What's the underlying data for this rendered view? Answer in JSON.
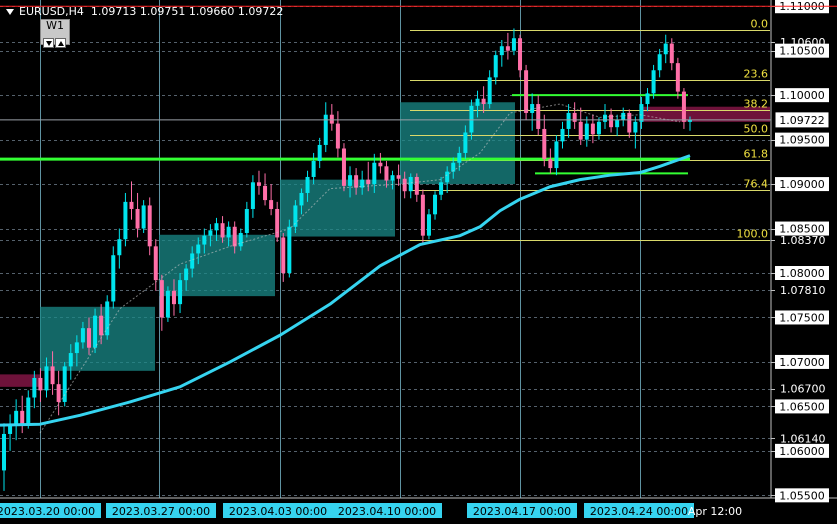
{
  "header": {
    "symbol": "EURUSD,H4",
    "ohlc": "1.09713 1.09751 1.09660 1.09722",
    "timeframe_button": "W1"
  },
  "colors": {
    "background": "#000000",
    "bull_candle": "#00e5ee",
    "bear_candle": "#ff6fa8",
    "ma_line": "#36d4f0",
    "fib_lines": "#d9d96a",
    "fib_labels": "#f0e040",
    "green_line": "#33ff33",
    "zone_fill": "#1a8a88",
    "supply_zone": "#7a1440",
    "grid": "#7a8a9a",
    "axis_text": "#ffffff",
    "current_price_bg": "#ffffff"
  },
  "chart_data": {
    "type": "candlestick",
    "symbol": "EURUSD",
    "timeframe": "H4",
    "y_ticks": [
      "1.11000",
      "1.10600",
      "1.10500",
      "1.10000",
      "1.09500",
      "1.09000",
      "1.08500",
      "1.08370",
      "1.08000",
      "1.07810",
      "1.07500",
      "1.07000",
      "1.06700",
      "1.06500",
      "1.06140",
      "1.06000",
      "1.05500"
    ],
    "y_ticks_boxed": [
      "1.11000",
      "1.10500",
      "1.10000",
      "1.09500",
      "1.09000",
      "1.08500",
      "1.08000",
      "1.07500",
      "1.07000",
      "1.06500",
      "1.06000",
      "1.05500"
    ],
    "y_range": [
      1.0547,
      1.1107
    ],
    "current_price": "1.09722",
    "x_labels": [
      {
        "text": "2023.03.20 00:00",
        "boxed": true
      },
      {
        "text": "2023.03.27 00:00",
        "boxed": true
      },
      {
        "text": "2023.04.03 00:00",
        "boxed": true
      },
      {
        "text": "2023.04.10 00:00",
        "boxed": true
      },
      {
        "text": "2023.04.17 00:00",
        "boxed": true
      },
      {
        "text": "2023.04.24 00:00",
        "boxed": true
      },
      {
        "text": "Apr 12:00",
        "boxed": false
      }
    ],
    "candles": [
      [
        1.0578,
        1.0631,
        1.0555,
        1.0619
      ],
      [
        1.0619,
        1.0641,
        1.06,
        1.0628
      ],
      [
        1.0628,
        1.0658,
        1.0612,
        1.0645
      ],
      [
        1.0645,
        1.0662,
        1.062,
        1.063
      ],
      [
        1.063,
        1.0668,
        1.0625,
        1.066
      ],
      [
        1.066,
        1.069,
        1.0648,
        1.0682
      ],
      [
        1.0682,
        1.0693,
        1.0655,
        1.0668
      ],
      [
        1.0668,
        1.0705,
        1.066,
        1.0695
      ],
      [
        1.0695,
        1.0712,
        1.0663,
        1.0675
      ],
      [
        1.0675,
        1.069,
        1.064,
        1.0655
      ],
      [
        1.0655,
        1.07,
        1.065,
        1.0695
      ],
      [
        1.0695,
        1.072,
        1.068,
        1.071
      ],
      [
        1.071,
        1.073,
        1.0695,
        1.0722
      ],
      [
        1.0722,
        1.0745,
        1.0715,
        1.0738
      ],
      [
        1.0738,
        1.075,
        1.0708,
        1.0716
      ],
      [
        1.0716,
        1.076,
        1.071,
        1.0752
      ],
      [
        1.0752,
        1.0765,
        1.072,
        1.073
      ],
      [
        1.073,
        1.0775,
        1.0725,
        1.0768
      ],
      [
        1.0768,
        1.083,
        1.076,
        1.082
      ],
      [
        1.082,
        1.085,
        1.0805,
        1.0838
      ],
      [
        1.0838,
        1.089,
        1.083,
        1.088
      ],
      [
        1.088,
        1.0903,
        1.086,
        1.0872
      ],
      [
        1.0872,
        1.089,
        1.084,
        1.085
      ],
      [
        1.085,
        1.0882,
        1.0845,
        1.0876
      ],
      [
        1.0876,
        1.0885,
        1.082,
        1.083
      ],
      [
        1.083,
        1.0838,
        1.078,
        1.0792
      ],
      [
        1.0792,
        1.0798,
        1.0735,
        1.075
      ],
      [
        1.075,
        1.0785,
        1.0745,
        1.078
      ],
      [
        1.078,
        1.0793,
        1.0752,
        1.0765
      ],
      [
        1.0765,
        1.08,
        1.0755,
        1.0792
      ],
      [
        1.0792,
        1.081,
        1.078,
        1.0805
      ],
      [
        1.0805,
        1.083,
        1.0795,
        1.0822
      ],
      [
        1.0822,
        1.084,
        1.081,
        1.0832
      ],
      [
        1.0832,
        1.085,
        1.0822,
        1.0842
      ],
      [
        1.0842,
        1.0855,
        1.083,
        1.0848
      ],
      [
        1.0848,
        1.0862,
        1.0836,
        1.0856
      ],
      [
        1.0856,
        1.0864,
        1.0834,
        1.084
      ],
      [
        1.084,
        1.0858,
        1.083,
        1.0852
      ],
      [
        1.0852,
        1.0858,
        1.0822,
        1.083
      ],
      [
        1.083,
        1.085,
        1.0825,
        1.0845
      ],
      [
        1.0845,
        1.088,
        1.084,
        1.0872
      ],
      [
        1.0872,
        1.091,
        1.0862,
        1.0902
      ],
      [
        1.0902,
        1.0915,
        1.0888,
        1.0898
      ],
      [
        1.0898,
        1.0912,
        1.0876,
        1.0882
      ],
      [
        1.0882,
        1.09,
        1.0865,
        1.0872
      ],
      [
        1.0872,
        1.088,
        1.0835,
        1.084
      ],
      [
        1.084,
        1.0845,
        1.079,
        1.08
      ],
      [
        1.08,
        1.086,
        1.0795,
        1.0852
      ],
      [
        1.0852,
        1.0882,
        1.0845,
        1.0876
      ],
      [
        1.0876,
        1.0895,
        1.0866,
        1.089
      ],
      [
        1.089,
        1.0915,
        1.088,
        1.0908
      ],
      [
        1.0908,
        1.0935,
        1.09,
        1.0926
      ],
      [
        1.0926,
        1.0952,
        1.0918,
        1.0944
      ],
      [
        1.0944,
        1.0992,
        1.0936,
        1.0978
      ],
      [
        1.0978,
        1.099,
        1.096,
        1.0968
      ],
      [
        1.0968,
        1.0982,
        1.093,
        1.094
      ],
      [
        1.094,
        1.0946,
        1.0892,
        1.0898
      ],
      [
        1.0898,
        1.092,
        1.0885,
        1.091
      ],
      [
        1.091,
        1.0918,
        1.0888,
        1.0896
      ],
      [
        1.0896,
        1.0915,
        1.0888,
        1.0905
      ],
      [
        1.0905,
        1.0925,
        1.0892,
        1.09
      ],
      [
        1.09,
        1.0934,
        1.089,
        1.0924
      ],
      [
        1.0924,
        1.0935,
        1.0912,
        1.092
      ],
      [
        1.092,
        1.0926,
        1.0896,
        1.0904
      ],
      [
        1.0904,
        1.0915,
        1.0894,
        1.091
      ],
      [
        1.091,
        1.0922,
        1.0898,
        1.0906
      ],
      [
        1.0906,
        1.0914,
        1.0884,
        1.0892
      ],
      [
        1.0892,
        1.0912,
        1.0884,
        1.0908
      ],
      [
        1.0908,
        1.0912,
        1.088,
        1.0888
      ],
      [
        1.0888,
        1.0894,
        1.0834,
        1.0842
      ],
      [
        1.0842,
        1.0872,
        1.0838,
        1.0866
      ],
      [
        1.0866,
        1.0892,
        1.086,
        1.0888
      ],
      [
        1.0888,
        1.0908,
        1.0882,
        1.0902
      ],
      [
        1.0902,
        1.092,
        1.089,
        1.0914
      ],
      [
        1.0914,
        1.093,
        1.0906,
        1.0924
      ],
      [
        1.0924,
        1.0942,
        1.0915,
        1.0935
      ],
      [
        1.0935,
        1.0966,
        1.0928,
        1.0958
      ],
      [
        1.0958,
        1.0995,
        1.095,
        1.0988
      ],
      [
        1.0988,
        1.1005,
        1.0975,
        1.0996
      ],
      [
        1.0996,
        1.101,
        1.098,
        1.099
      ],
      [
        1.099,
        1.1028,
        1.0985,
        1.102
      ],
      [
        1.102,
        1.105,
        1.1012,
        1.1045
      ],
      [
        1.1045,
        1.1062,
        1.1032,
        1.1055
      ],
      [
        1.1055,
        1.107,
        1.104,
        1.105
      ],
      [
        1.105,
        1.1075,
        1.1045,
        1.1064
      ],
      [
        1.1064,
        1.1068,
        1.102,
        1.1028
      ],
      [
        1.1028,
        1.1034,
        1.0972,
        1.098
      ],
      [
        1.098,
        1.1002,
        1.096,
        1.099
      ],
      [
        1.099,
        1.1,
        1.0955,
        1.0962
      ],
      [
        1.0962,
        1.0978,
        1.092,
        1.0928
      ],
      [
        1.0928,
        1.094,
        1.0912,
        1.0918
      ],
      [
        1.0918,
        1.0955,
        1.091,
        1.0948
      ],
      [
        1.0948,
        1.097,
        1.094,
        1.0962
      ],
      [
        1.0962,
        1.099,
        1.0952,
        1.098
      ],
      [
        1.098,
        1.0992,
        1.0962,
        1.097
      ],
      [
        1.097,
        1.0986,
        1.0944,
        1.095
      ],
      [
        1.095,
        1.0976,
        1.0942,
        1.0968
      ],
      [
        1.0968,
        1.0978,
        1.0946,
        1.0956
      ],
      [
        1.0956,
        1.0975,
        1.095,
        1.097
      ],
      [
        1.097,
        1.099,
        1.0962,
        1.0978
      ],
      [
        1.0978,
        1.0985,
        1.0958,
        1.0964
      ],
      [
        1.0964,
        1.0978,
        1.0954,
        1.0972
      ],
      [
        1.0972,
        1.0986,
        1.0965,
        1.098
      ],
      [
        1.098,
        1.0984,
        1.0952,
        1.0958
      ],
      [
        1.0958,
        1.0976,
        1.094,
        1.097
      ],
      [
        1.097,
        1.0998,
        1.0962,
        1.099
      ],
      [
        1.099,
        1.1008,
        1.0982,
        1.1002
      ],
      [
        1.1002,
        1.1034,
        1.0996,
        1.1028
      ],
      [
        1.1028,
        1.1052,
        1.102,
        1.1046
      ],
      [
        1.1046,
        1.1068,
        1.1036,
        1.1058
      ],
      [
        1.1058,
        1.1064,
        1.1028,
        1.1036
      ],
      [
        1.1036,
        1.1042,
        1.0996,
        1.1004
      ],
      [
        1.1004,
        1.1008,
        1.0962,
        1.097
      ],
      [
        1.097,
        1.0976,
        1.096,
        1.0972
      ]
    ],
    "moving_average": [
      [
        0,
        1.0629
      ],
      [
        40,
        1.063
      ],
      [
        80,
        1.064
      ],
      [
        130,
        1.0655
      ],
      [
        180,
        1.0672
      ],
      [
        230,
        1.07
      ],
      [
        280,
        1.073
      ],
      [
        330,
        1.0765
      ],
      [
        380,
        1.0808
      ],
      [
        420,
        1.0832
      ],
      [
        460,
        1.0842
      ],
      [
        480,
        1.0852
      ],
      [
        500,
        1.087
      ],
      [
        520,
        1.0883
      ],
      [
        550,
        1.0897
      ],
      [
        580,
        1.0905
      ],
      [
        610,
        1.091
      ],
      [
        640,
        1.0913
      ],
      [
        660,
        1.092
      ],
      [
        690,
        1.0932
      ]
    ],
    "signal_line": [
      [
        40,
        1.062
      ],
      [
        120,
        1.076
      ],
      [
        180,
        1.081
      ],
      [
        230,
        1.083
      ],
      [
        290,
        1.085
      ],
      [
        330,
        1.0895
      ],
      [
        400,
        1.09
      ],
      [
        440,
        1.0905
      ],
      [
        480,
        1.0935
      ],
      [
        510,
        1.098
      ],
      [
        560,
        1.099
      ],
      [
        600,
        1.0975
      ],
      [
        640,
        1.0978
      ],
      [
        680,
        1.097
      ]
    ],
    "fib_levels": [
      {
        "label": "0.0",
        "price": 1.1073
      },
      {
        "label": "23.6",
        "price": 1.1017
      },
      {
        "label": "38.2",
        "price": 1.0983
      },
      {
        "label": "50.0",
        "price": 1.0955
      },
      {
        "label": "61.8",
        "price": 1.0927
      },
      {
        "label": "76.4",
        "price": 1.0893
      },
      {
        "label": "100.0",
        "price": 1.0837
      }
    ],
    "green_lines": [
      1.0928,
      1.1,
      1.0912
    ],
    "zones": [
      {
        "type": "demand",
        "from_x": 40,
        "to_x": 155,
        "top": 1.0762,
        "bottom": 1.069
      },
      {
        "type": "demand",
        "from_x": 159,
        "to_x": 275,
        "top": 1.0843,
        "bottom": 1.0774
      },
      {
        "type": "demand",
        "from_x": 280,
        "to_x": 395,
        "top": 1.0905,
        "bottom": 1.0841
      },
      {
        "type": "demand",
        "from_x": 400,
        "to_x": 515,
        "top": 1.0992,
        "bottom": 1.09
      },
      {
        "type": "supply",
        "from_x": 0,
        "to_x": 40,
        "top": 1.0686,
        "bottom": 1.0672
      },
      {
        "type": "supply",
        "from_x": 640,
        "to_x": 770,
        "top": 1.0987,
        "bottom": 1.097
      }
    ]
  }
}
